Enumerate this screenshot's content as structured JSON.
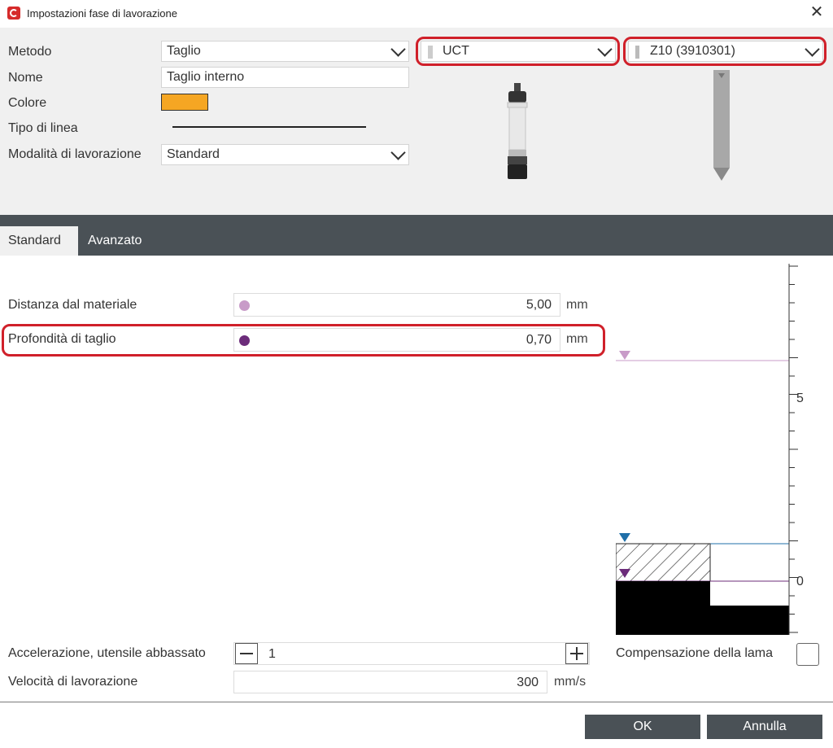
{
  "window": {
    "title": "Impostazioni fase di lavorazione",
    "close_label": "✕"
  },
  "form": {
    "metodo_label": "Metodo",
    "metodo_value": "Taglio",
    "nome_label": "Nome",
    "nome_value": "Taglio interno",
    "colore_label": "Colore",
    "colore_value": "#f5a623",
    "tipo_linea_label": "Tipo di linea",
    "modalita_label": "Modalità di lavorazione",
    "modalita_value": "Standard",
    "tool_value": "UCT",
    "blade_value": "Z10 (3910301)"
  },
  "tabs": [
    {
      "label": "Standard"
    },
    {
      "label": "Avanzato"
    }
  ],
  "params": {
    "distanza_label": "Distanza dal materiale",
    "distanza_value": "5,00",
    "distanza_unit": "mm",
    "profondita_label": "Profondità di taglio",
    "profondita_value": "0,70",
    "profondita_unit": "mm",
    "accelerazione_label": "Accelerazione, utensile abbassato",
    "accelerazione_value": "1",
    "velocita_label": "Velocità di lavorazione",
    "velocita_value": "300",
    "velocita_unit": "mm/s",
    "compensazione_label": "Compensazione della lama"
  },
  "colors": {
    "distance_marker": "#c89bc8",
    "depth_marker": "#6c2c7a",
    "material_marker": "#1f6fa8",
    "highlight": "#d0202a"
  },
  "scale": {
    "tick_5": "5",
    "tick_0": "0"
  },
  "buttons": {
    "ok": "OK",
    "cancel": "Annulla"
  }
}
